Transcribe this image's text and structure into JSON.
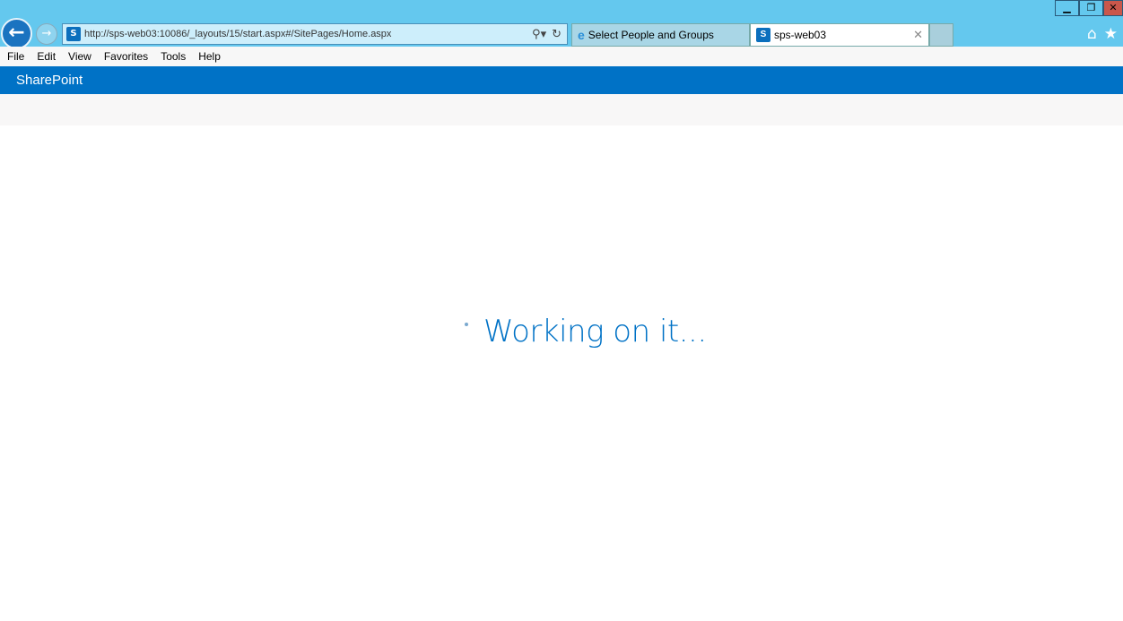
{
  "browser": {
    "url": "http://sps-web03:10086/_layouts/15/start.aspx#/SitePages/Home.aspx",
    "tabs": [
      {
        "label": "Select People and Groups",
        "icon": "ie-icon"
      },
      {
        "label": "sps-web03",
        "icon": "sharepoint-icon",
        "active": true
      }
    ],
    "close_tab": "✕"
  },
  "menu": [
    "File",
    "Edit",
    "View",
    "Favorites",
    "Tools",
    "Help"
  ],
  "suite": {
    "title": "SharePoint"
  },
  "status": {
    "text": "Working on it..."
  },
  "colors": {
    "suite_bar": "#0072c6",
    "chrome": "#64c8ee",
    "text_accent": "#0072c6"
  }
}
